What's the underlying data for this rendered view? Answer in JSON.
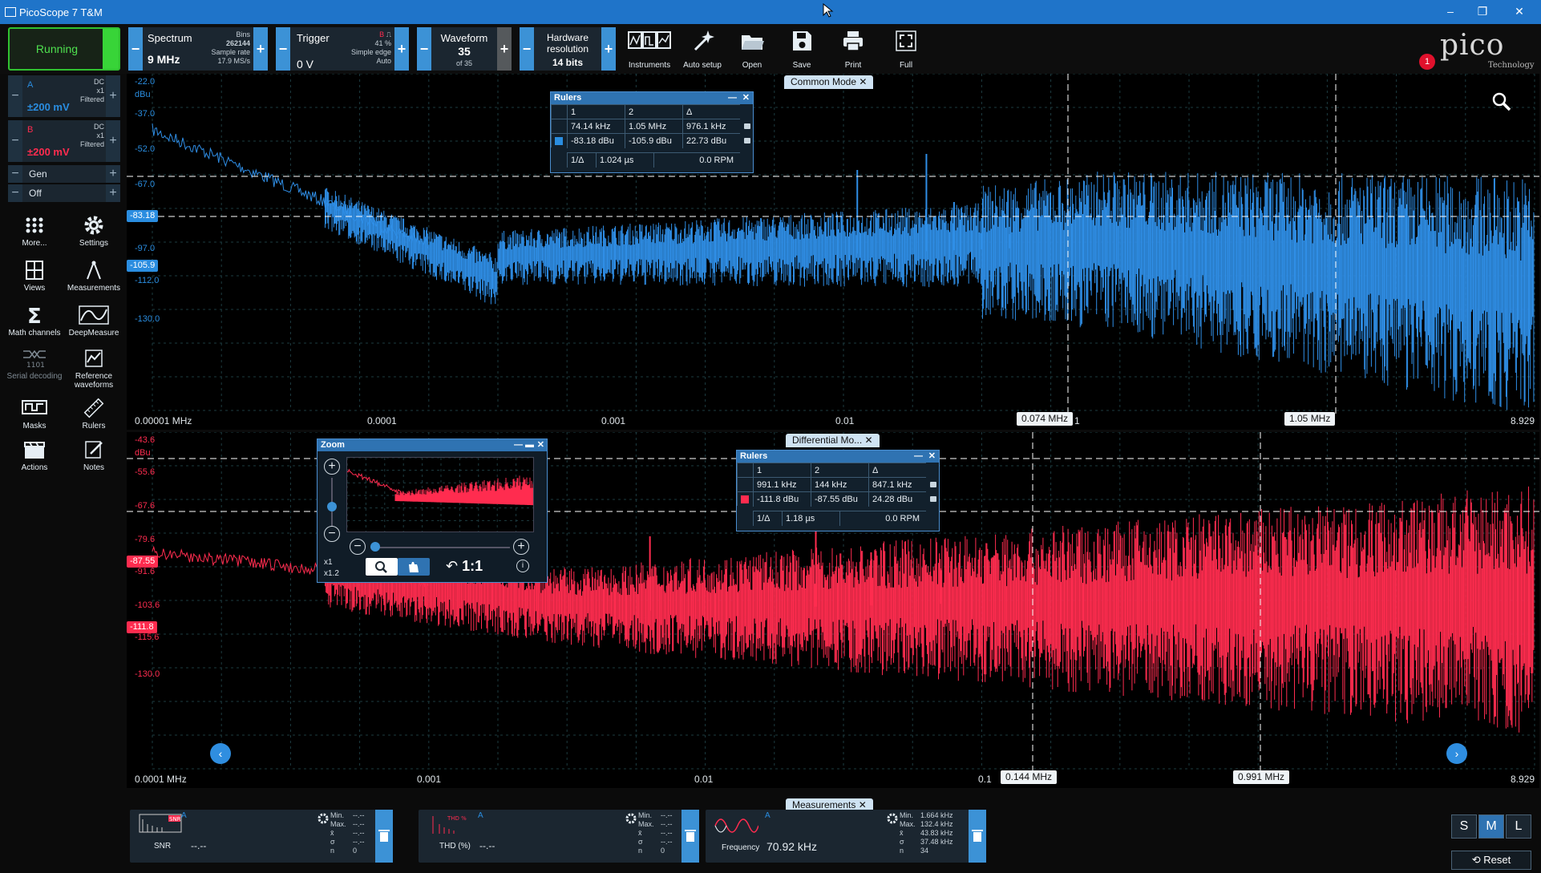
{
  "window": {
    "title": "PicoScope 7 T&M"
  },
  "toolbar": {
    "run_label": "Running",
    "spectrum": {
      "title": "Spectrum",
      "value": "9 MHz",
      "bins_label": "Bins",
      "bins": "262144",
      "rate_label": "Sample rate",
      "rate": "17.9 MS/s"
    },
    "trigger": {
      "title": "Trigger",
      "value": "0 V",
      "channel": "B",
      "pct": "41 %",
      "mode": "Simple edge",
      "auto": "Auto"
    },
    "waveform": {
      "title": "Waveform",
      "value": "35",
      "of": "of 35"
    },
    "hardware": {
      "title": "Hardware resolution",
      "value": "14 bits"
    },
    "tools": [
      {
        "label": "Instruments"
      },
      {
        "label": "Auto setup"
      },
      {
        "label": "Open"
      },
      {
        "label": "Save"
      },
      {
        "label": "Print"
      },
      {
        "label": "Full"
      }
    ],
    "logo": {
      "word": "pico",
      "sub": "Technology",
      "badge": "1"
    }
  },
  "sidebar": {
    "channel_a": {
      "name": "A",
      "range": "±200 mV",
      "coupling": "DC",
      "probe": "x1",
      "filter": "Filtered",
      "color": "#2a8de0"
    },
    "channel_b": {
      "name": "B",
      "range": "±200 mV",
      "coupling": "DC",
      "probe": "x1",
      "filter": "Filtered",
      "color": "#ff2c4f"
    },
    "gen": {
      "label": "Gen",
      "value": "Off"
    },
    "items": [
      {
        "label": "More..."
      },
      {
        "label": "Settings"
      },
      {
        "label": "Views"
      },
      {
        "label": "Measurements"
      },
      {
        "label": "Math channels"
      },
      {
        "label": "DeepMeasure"
      },
      {
        "label": "Serial decoding"
      },
      {
        "label": "Reference waveforms"
      },
      {
        "label": "Masks"
      },
      {
        "label": "Rulers"
      },
      {
        "label": "Actions"
      },
      {
        "label": "Notes"
      }
    ]
  },
  "view_top": {
    "title": "Common Mode",
    "unit": "dBu",
    "y_ticks": [
      "-22.0",
      "-37.0",
      "-52.0",
      "-67.0",
      "-97.0",
      "-112.0",
      "-130.0"
    ],
    "x_ticks": [
      "0.00001 MHz",
      "0.0001",
      "0.001",
      "0.01",
      "1",
      "8.929"
    ],
    "ruler_y": [
      "-83.18",
      "-105.9"
    ],
    "markers": [
      "0.074 MHz",
      "1.05 MHz"
    ],
    "rulers": {
      "title": "Rulers",
      "h1": "1",
      "h2": "2",
      "hd": "Δ",
      "r1": [
        "74.14 kHz",
        "1.05 MHz",
        "976.1 kHz"
      ],
      "r2": [
        "-83.18 dBu",
        "-105.9 dBu",
        "22.73 dBu"
      ],
      "r3": [
        "1/Δ",
        "1.024 µs",
        "0.0 RPM"
      ]
    }
  },
  "view_bottom": {
    "title": "Differential Mo...",
    "unit": "dBu",
    "y_ticks": [
      "-43.6",
      "-55.6",
      "-67.6",
      "-79.6",
      "-91.6",
      "-103.6",
      "-115.6",
      "-130.0"
    ],
    "x_ticks": [
      "0.0001 MHz",
      "0.001",
      "0.01",
      "0.1",
      "8.929"
    ],
    "ruler_y": [
      "-87.55",
      "-111.8"
    ],
    "markers": [
      "0.144 MHz",
      "0.991 MHz"
    ],
    "rulers": {
      "title": "Rulers",
      "h1": "1",
      "h2": "2",
      "hd": "Δ",
      "r1": [
        "991.1 kHz",
        "144 kHz",
        "847.1 kHz"
      ],
      "r2": [
        "-111.8 dBu",
        "-87.55 dBu",
        "24.28 dBu"
      ],
      "r3": [
        "1/Δ",
        "1.18 µs",
        "0.0 RPM"
      ]
    }
  },
  "zoom": {
    "title": "Zoom",
    "x1": "x1",
    "x12": "x1.2",
    "ratio": "1:1"
  },
  "measurements": {
    "title": "Measurements",
    "items": [
      {
        "name": "SNR",
        "channel": "A",
        "value": "--.--",
        "min": "--.--",
        "max": "--.--",
        "mean": "--.--",
        "sd": "--.--",
        "n": "0"
      },
      {
        "name": "THD (%)",
        "channel": "A",
        "value": "--.--",
        "min": "--.--",
        "max": "--.--",
        "mean": "--.--",
        "sd": "--.--",
        "n": "0"
      },
      {
        "name": "Frequency",
        "channel": "A",
        "value": "70.92 kHz",
        "min": "1.664 kHz",
        "max": "132.4 kHz",
        "mean": "43.83 kHz",
        "sd": "37.48 kHz",
        "n": "34"
      }
    ],
    "stat_labels": [
      "Min.",
      "Max.",
      "x̄",
      "σ",
      "n"
    ],
    "sizes": [
      "S",
      "M",
      "L"
    ],
    "reset": "Reset"
  }
}
